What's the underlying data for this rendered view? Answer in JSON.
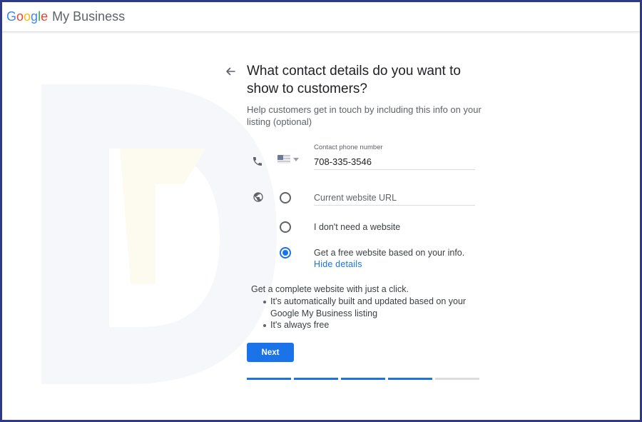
{
  "header": {
    "logo_letters": [
      "G",
      "o",
      "o",
      "g",
      "l",
      "e"
    ],
    "product_name": "My Business"
  },
  "page": {
    "title": "What contact details do you want to show to customers?",
    "subtitle": "Help customers get in touch by including this info on your listing (optional)"
  },
  "phone": {
    "label": "Contact phone number",
    "value": "708-335-3546",
    "country_icon": "us-flag-icon"
  },
  "website": {
    "url_placeholder": "Current website URL",
    "options": [
      {
        "label": "I don't need a website",
        "selected": false
      },
      {
        "label": "Get a free website based on your info.",
        "selected": true
      }
    ],
    "hide_details_label": "Hide details"
  },
  "details": {
    "intro": "Get a complete website with just a click.",
    "bullets": [
      "It's automatically built and updated based on your Google My Business listing",
      "It's always free"
    ]
  },
  "actions": {
    "next_label": "Next"
  },
  "progress": {
    "total_steps": 5,
    "completed_steps": 4
  },
  "colors": {
    "accent": "#1a73e8",
    "frame_border": "#2e3a87"
  },
  "icons": {
    "back": "arrow-back-icon",
    "phone": "phone-icon",
    "globe": "globe-icon"
  }
}
